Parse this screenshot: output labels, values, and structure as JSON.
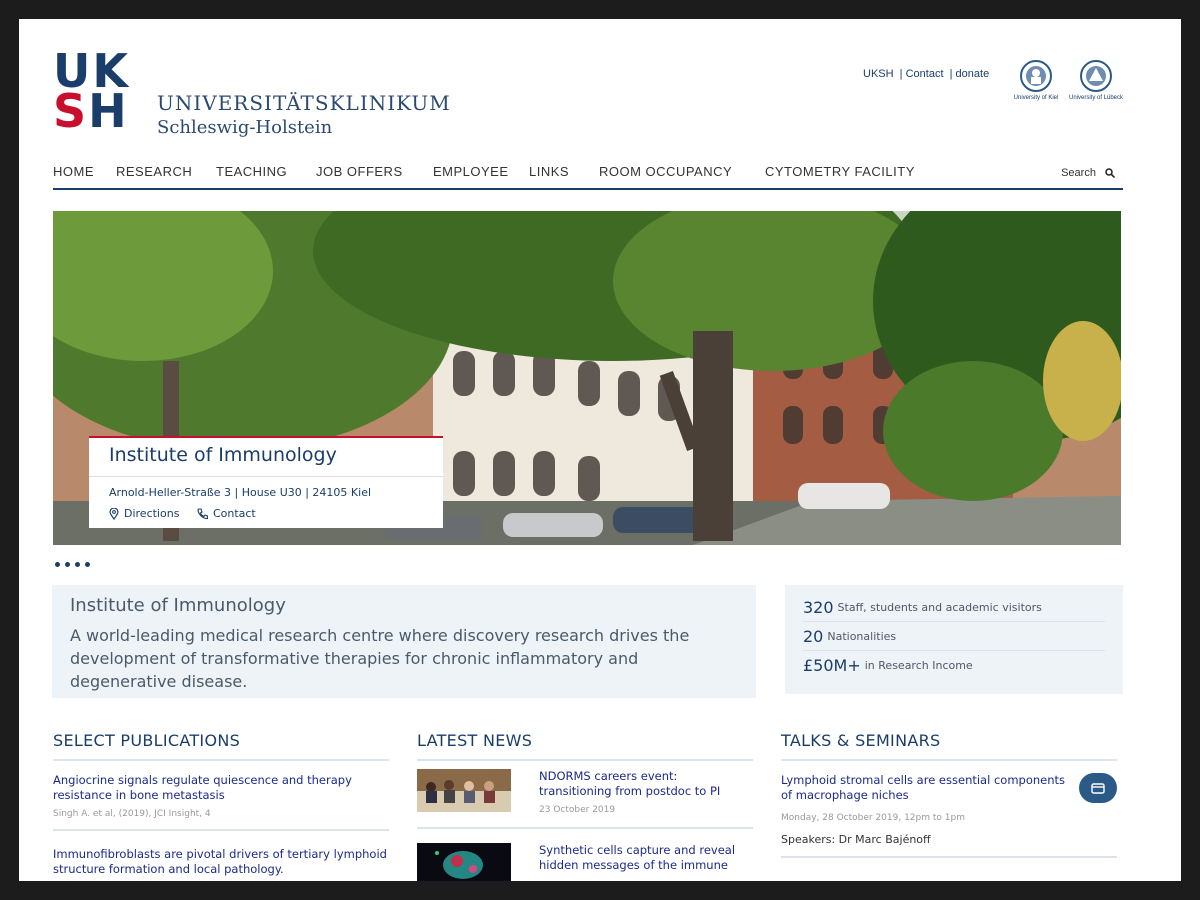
{
  "brand": {
    "mark_top": "UK",
    "mark_bottom_s": "S",
    "mark_bottom_h": "H",
    "name_line1": "UNIVERSITÄTSKLINIKUM",
    "name_line2": "Schleswig-Holstein"
  },
  "top_links": [
    "UKSH",
    "Contact",
    "donate"
  ],
  "partners": [
    {
      "label": "University of Kiel",
      "icon": "kiel-seal-icon"
    },
    {
      "label": "University of Lübeck",
      "icon": "luebeck-seal-icon"
    }
  ],
  "nav": {
    "items": [
      "HOME",
      "RESEARCH",
      "TEACHING",
      "JOB OFFERS",
      "EMPLOYEE",
      "LINKS",
      "ROOM OCCUPANCY",
      "CYTOMETRY FACILITY"
    ],
    "search_label": "Search"
  },
  "hero": {
    "title": "Institute of Immunology",
    "address": "Arnold-Heller-Straße 3 | House U30 | 24105 Kiel",
    "directions": "Directions",
    "contact": "Contact",
    "slides_count": 4
  },
  "intro": {
    "title": "Institute of Immunology",
    "text": "A world-leading medical research centre where discovery research drives the development of transformative therapies for chronic inflammatory and degenerative disease."
  },
  "stats": [
    {
      "num": "320",
      "label": "Staff, students and academic visitors"
    },
    {
      "num": "20",
      "label": "Nationalities"
    },
    {
      "num": "£50M+",
      "label": "in Research Income"
    }
  ],
  "publications": {
    "heading": "SELECT PUBLICATIONS",
    "items": [
      {
        "title": "Angiocrine signals regulate quiescence and therapy resistance in bone metastasis",
        "meta": "Singh A. et al, (2019), JCI Insight, 4"
      },
      {
        "title": "Immunofibroblasts are pivotal drivers of tertiary lymphoid structure formation and local pathology.",
        "meta": ""
      }
    ]
  },
  "news": {
    "heading": "LATEST NEWS",
    "items": [
      {
        "title": "NDORMS careers event: transitioning from postdoc to PI",
        "date": "23 October 2019"
      },
      {
        "title": "Synthetic cells capture and reveal hidden messages of the immune",
        "date": ""
      }
    ]
  },
  "talks": {
    "heading": "TALKS & SEMINARS",
    "items": [
      {
        "title": "Lymphoid stromal cells are essential components of macrophage niches",
        "when": "Monday, 28 October 2019, 12pm to 1pm",
        "speakers": "Speakers: Dr Marc Bajénoff"
      }
    ]
  },
  "colors": {
    "navy": "#1b3d6a",
    "red": "#c8102e",
    "link": "#1b2a8a",
    "panel": "#eef3f8"
  }
}
